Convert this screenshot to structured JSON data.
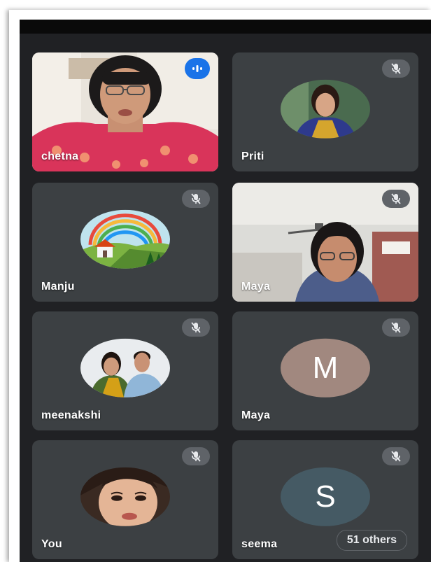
{
  "colors": {
    "background": "#202124",
    "tile": "#3c4043",
    "mute_pill": "#5f6368",
    "speaking_badge": "#1a73e8",
    "avatar_m": "#a1887f",
    "avatar_s": "#455a64"
  },
  "participants": [
    {
      "name": "chetna",
      "media": "video",
      "status": "speaking",
      "icon": "speaking-indicator-icon"
    },
    {
      "name": "Priti",
      "media": "photo-avatar",
      "status": "muted",
      "icon": "mic-off-icon"
    },
    {
      "name": "Manju",
      "media": "photo-avatar",
      "status": "muted",
      "icon": "mic-off-icon"
    },
    {
      "name": "Maya",
      "media": "video",
      "status": "muted",
      "icon": "mic-off-icon"
    },
    {
      "name": "meenakshi",
      "media": "photo-avatar",
      "status": "muted",
      "icon": "mic-off-icon"
    },
    {
      "name": "Maya",
      "media": "letter-avatar",
      "initial": "M",
      "status": "muted",
      "icon": "mic-off-icon"
    },
    {
      "name": "You",
      "media": "photo-avatar",
      "status": "muted",
      "icon": "mic-off-icon"
    },
    {
      "name": "seema",
      "media": "letter-avatar",
      "initial": "S",
      "status": "muted",
      "icon": "mic-off-icon"
    }
  ],
  "others_label": "51 others"
}
